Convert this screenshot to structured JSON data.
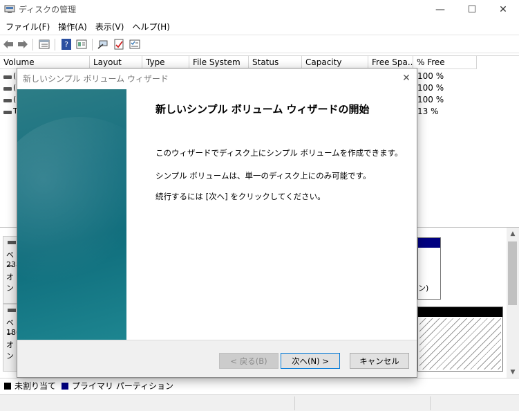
{
  "window": {
    "title": "ディスクの管理",
    "controls": {
      "minimize": "—",
      "maximize": "☐",
      "close": "✕"
    }
  },
  "menu": [
    "ファイル(F)",
    "操作(A)",
    "表示(V)",
    "ヘルプ(H)"
  ],
  "toolbar": {
    "icons": [
      "back-arrow-icon",
      "forward-arrow-icon",
      "disk-list-icon",
      "help-icon",
      "properties-icon",
      "connect-icon",
      "check-icon",
      "settings-list-icon"
    ]
  },
  "volume_list": {
    "columns": [
      "Volume",
      "Layout",
      "Type",
      "File System",
      "Status",
      "Capacity",
      "Free Spa...",
      "% Free"
    ],
    "rows": [
      {
        "stub": "(",
        "pct_free": "100 %"
      },
      {
        "stub": "(",
        "pct_free": "100 %"
      },
      {
        "stub": "(",
        "pct_free": "100 %"
      },
      {
        "stub": "T",
        "pct_free": "13 %"
      }
    ]
  },
  "disk_area": {
    "disk1": {
      "l1": "ベー",
      "l2": "238",
      "l3": "オン"
    },
    "disk2": {
      "l1": "ベー",
      "l2": "186",
      "l3": "オン"
    },
    "partition_text": "ン)"
  },
  "legend": {
    "unallocated": "未割り当て",
    "primary": "プライマリ パーティション",
    "colors": {
      "unallocated": "#000000",
      "primary": "#000080"
    }
  },
  "dialog": {
    "title": "新しいシンプル ボリューム ウィザード",
    "heading": "新しいシンプル ボリューム ウィザードの開始",
    "para1": "このウィザードでディスク上にシンプル ボリュームを作成できます。",
    "para2": "シンプル ボリュームは、単一のディスク上にのみ可能です。",
    "para3": "続行するには [次へ] をクリックしてください。",
    "buttons": {
      "back": "< 戻る(B)",
      "next": "次へ(N) >",
      "cancel": "キャンセル"
    },
    "banner_color": "#177080"
  }
}
